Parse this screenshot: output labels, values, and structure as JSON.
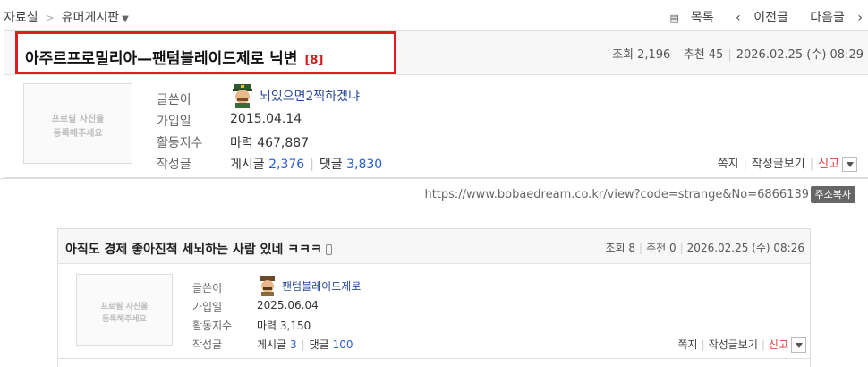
{
  "nav": {
    "board_root": "자료실",
    "board_name": "유머게시판",
    "list_label": "목록",
    "prev_label": "이전글",
    "next_label": "다음글"
  },
  "post": {
    "title": "아주르프로밀리아—팬텀블레이드제로 닉변",
    "comment_count": "[8]",
    "views": "조회 2,196",
    "recommends": "추천 45",
    "datetime": "2026.02.25 (수) 08:29",
    "profile_placeholder": [
      "프로필 사진을",
      "등록해주세요"
    ],
    "labels": {
      "author": "글쓴이",
      "joined": "가입일",
      "activity": "활동지수",
      "posts": "작성글"
    },
    "author": "뇌있으면2찍하겠냐",
    "joined": "2015.04.14",
    "activity": "마력 467,887",
    "post_count_label": "게시글",
    "post_count": "2,376",
    "comment_count_label": "댓글",
    "comment_total": "3,830",
    "actions": {
      "message": "쪽지",
      "view_posts": "작성글보기",
      "report": "신고"
    }
  },
  "link": {
    "url": "https://www.bobaedream.co.kr/view?code=strange&No=6866139",
    "copy_label": "주소복사"
  },
  "quoted": {
    "title": "아직도 경제 좋아진척 세뇌하는 사람 있네 ㅋㅋㅋ",
    "views": "조회 8",
    "recommends": "추천 0",
    "datetime": "2026.02.25 (수) 08:26",
    "profile_placeholder": [
      "프로필 사진을",
      "등록해주세요"
    ],
    "labels": {
      "author": "글쓴이",
      "joined": "가입일",
      "activity": "활동지수",
      "posts": "작성글"
    },
    "author": "팬텀블레이드제로",
    "joined": "2025.06.04",
    "activity": "마력 3,150",
    "post_count_label": "게시글",
    "post_count": "3",
    "comment_count_label": "댓글",
    "comment_total": "100",
    "actions": {
      "message": "쪽지",
      "view_posts": "작성글보기",
      "report": "신고"
    }
  },
  "colors": {
    "highlight_border": "#e21b22",
    "link_blue": "#2a5bd7",
    "report_red": "#e03c3c"
  }
}
